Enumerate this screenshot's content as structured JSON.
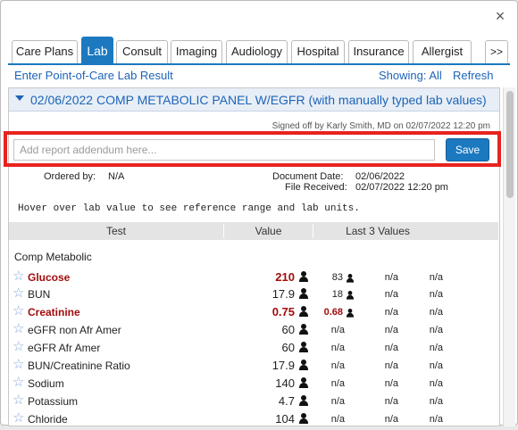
{
  "window": {
    "close_glyph": "×"
  },
  "tabs": [
    {
      "label": "Care Plans",
      "active": false
    },
    {
      "label": "Lab",
      "active": true
    },
    {
      "label": "Consult",
      "active": false
    },
    {
      "label": "Imaging",
      "active": false
    },
    {
      "label": "Audiology",
      "active": false
    },
    {
      "label": "Hospital",
      "active": false
    },
    {
      "label": "Insurance",
      "active": false
    },
    {
      "label": "Allergist",
      "active": false
    },
    {
      "label": ">>",
      "active": false
    }
  ],
  "toolbar": {
    "enter_poc": "Enter Point-of-Care Lab Result",
    "showing": "Showing: All",
    "refresh": "Refresh"
  },
  "panel": {
    "title": "02/06/2022   COMP METABOLIC PANEL W/EGFR (with manually typed lab values)",
    "signed": "Signed off by Karly Smith, MD on 02/07/2022 12:20 pm",
    "addendum_placeholder": "Add report addendum here...",
    "save_label": "Save",
    "ordered_by_label": "Ordered by:",
    "ordered_by_value": "N/A",
    "document_date_label": "Document Date:",
    "document_date_value": "02/06/2022",
    "file_received_label": "File Received:",
    "file_received_value": "02/07/2022 12:20 pm",
    "hover_hint": "Hover over lab value to see reference range and lab units."
  },
  "table": {
    "col_test": "Test",
    "col_value": "Value",
    "col_last3": "Last 3 Values",
    "section": "Comp Metabolic",
    "rows": [
      {
        "test": "Glucose",
        "value": "210",
        "flag": true,
        "last": [
          "83",
          "n/a",
          "n/a"
        ],
        "last_flag": false,
        "last_icon": true
      },
      {
        "test": "BUN",
        "value": "17.9",
        "flag": false,
        "last": [
          "18",
          "n/a",
          "n/a"
        ],
        "last_flag": false,
        "last_icon": true
      },
      {
        "test": "Creatinine",
        "value": "0.75",
        "flag": true,
        "last": [
          "0.68",
          "n/a",
          "n/a"
        ],
        "last_flag": true,
        "last_icon": true
      },
      {
        "test": "eGFR non Afr Amer",
        "value": "60",
        "flag": false,
        "last": [
          "n/a",
          "n/a",
          "n/a"
        ],
        "last_flag": false,
        "last_icon": false
      },
      {
        "test": "eGFR Afr Amer",
        "value": "60",
        "flag": false,
        "last": [
          "n/a",
          "n/a",
          "n/a"
        ],
        "last_flag": false,
        "last_icon": false
      },
      {
        "test": "BUN/Creatinine Ratio",
        "value": "17.9",
        "flag": false,
        "last": [
          "n/a",
          "n/a",
          "n/a"
        ],
        "last_flag": false,
        "last_icon": false
      },
      {
        "test": "Sodium",
        "value": "140",
        "flag": false,
        "last": [
          "n/a",
          "n/a",
          "n/a"
        ],
        "last_flag": false,
        "last_icon": false
      },
      {
        "test": "Potassium",
        "value": "4.7",
        "flag": false,
        "last": [
          "n/a",
          "n/a",
          "n/a"
        ],
        "last_flag": false,
        "last_icon": false
      },
      {
        "test": "Chloride",
        "value": "104",
        "flag": false,
        "last": [
          "n/a",
          "n/a",
          "n/a"
        ],
        "last_flag": false,
        "last_icon": false
      }
    ]
  },
  "colors": {
    "accent": "#1c79c0",
    "flag": "#a10c0c",
    "highlight": "#e8231f"
  }
}
